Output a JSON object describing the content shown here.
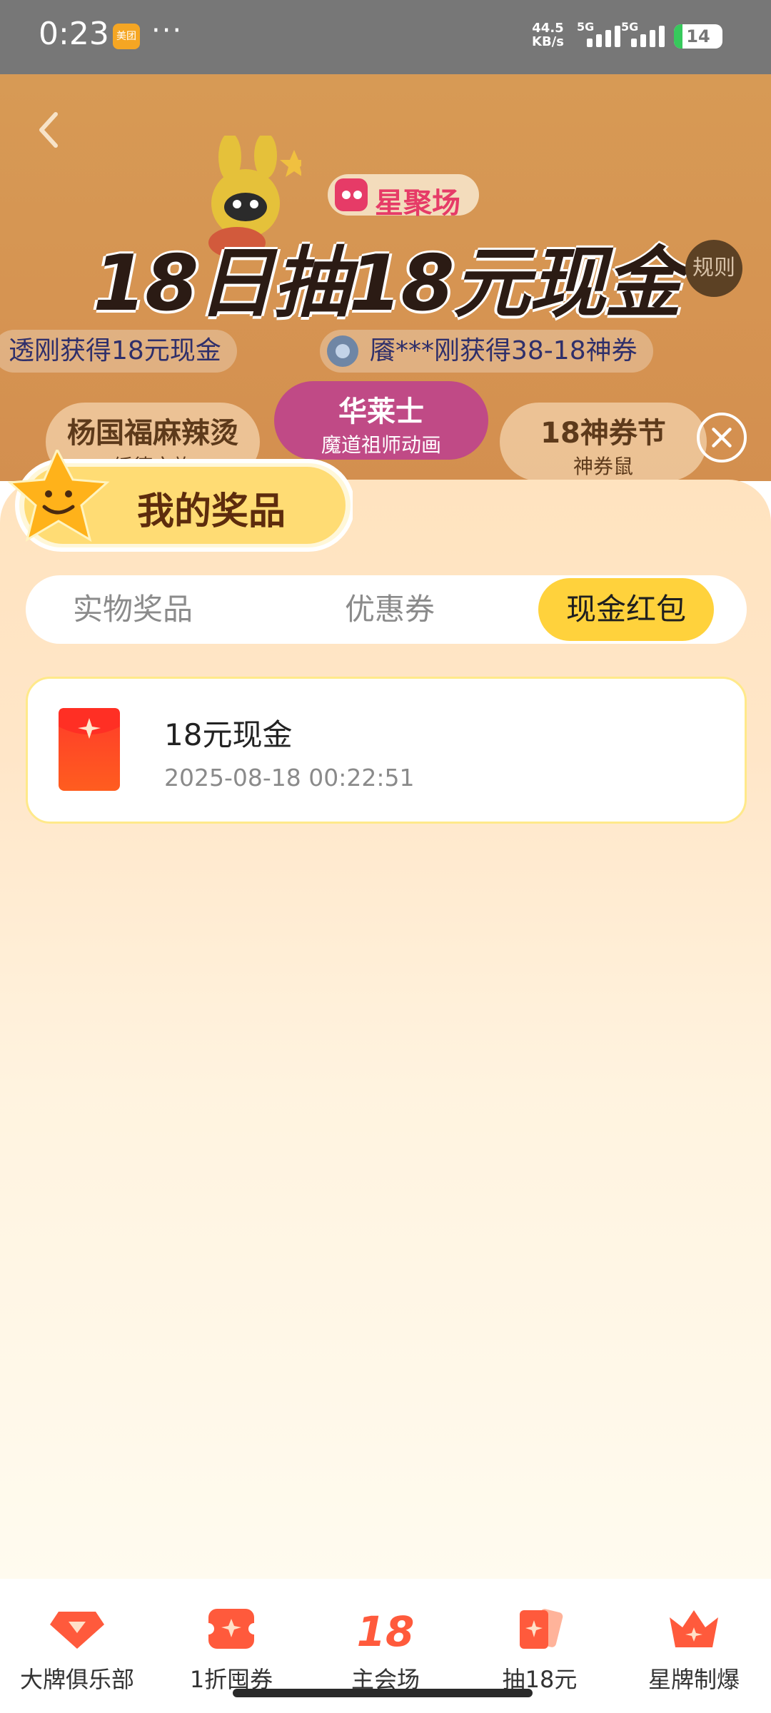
{
  "status_bar": {
    "time": "0:23",
    "app_badge": "美团",
    "dots": "···",
    "net_speed": "44.5",
    "net_unit": "KB/s",
    "sim1": "5G",
    "sim2": "5G",
    "battery": "14"
  },
  "banner": {
    "brand": "星聚场",
    "title": "18日抽18元现金",
    "rules": "规则"
  },
  "tickers": [
    "透刚获得18元现金",
    "餍***刚获得38-18神券"
  ],
  "chips": [
    {
      "title": "杨国福麻辣烫",
      "sub": "绥德文旅"
    },
    {
      "title": "华莱士",
      "sub": "魔道祖师动画"
    },
    {
      "title": "18神券节",
      "sub": "神券鼠"
    }
  ],
  "panel": {
    "title": "我的奖品",
    "tabs": [
      "实物奖品",
      "优惠券",
      "现金红包"
    ],
    "active_tab": "现金红包",
    "prizes": [
      {
        "name": "18元现金",
        "time": "2025-08-18 00:22:51"
      }
    ]
  },
  "bottom_nav": [
    {
      "label": "大牌俱乐部",
      "icon": "diamond-icon"
    },
    {
      "label": "1折囤券",
      "icon": "ticket-icon"
    },
    {
      "label": "主会场",
      "icon": "eighteen-icon"
    },
    {
      "label": "抽18元",
      "icon": "cards-icon"
    },
    {
      "label": "星牌制爆",
      "icon": "crown-icon"
    }
  ],
  "colors": {
    "accent": "#ffd23c",
    "brand": "#ff5a2c",
    "status_bar": "#777777"
  }
}
